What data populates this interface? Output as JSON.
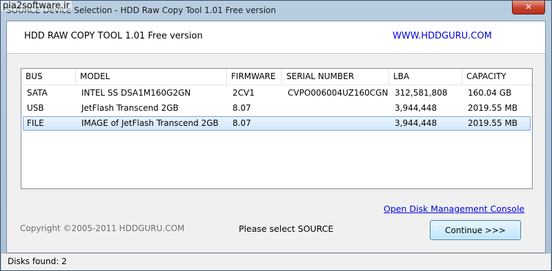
{
  "window": {
    "title": "SOURCE Device Selection - HDD Raw Copy Tool 1.01    Free version",
    "watermark": "pia2software.ir",
    "close_glyph": "✕"
  },
  "header": {
    "app_name": "HDD RAW COPY TOOL 1.01    Free version",
    "website": "WWW.HDDGURU.COM"
  },
  "table": {
    "columns": [
      "BUS",
      "MODEL",
      "FIRMWARE",
      "SERIAL NUMBER",
      "LBA",
      "CAPACITY"
    ],
    "rows": [
      {
        "bus": "SATA",
        "model": "INTEL SS DSA1M160G2GN",
        "firmware": "2CV1",
        "serial": "CVPO006004UZ160CGN",
        "lba": "312,581,808",
        "capacity": "160.04 GB",
        "selected": false
      },
      {
        "bus": "USB",
        "model": "JetFlash Transcend 2GB",
        "firmware": "8.07",
        "serial": "",
        "lba": "3,944,448",
        "capacity": "2019.55 MB",
        "selected": false
      },
      {
        "bus": "FILE",
        "model": "IMAGE of JetFlash Transcend 2GB",
        "firmware": "8.07",
        "serial": "",
        "lba": "3,944,448",
        "capacity": "2019.55 MB",
        "selected": true
      }
    ]
  },
  "footer": {
    "disk_mgmt_link": "Open Disk Management Console",
    "copyright": "Copyright ©2005-2011 HDDGURU.COM",
    "status_message": "Please select SOURCE",
    "continue_label": "Continue >>>"
  },
  "statusbar": {
    "disks_found": "Disks found: 2"
  },
  "colors": {
    "link": "#0000e0",
    "selection": "#d2e7fc",
    "close_button": "#c9412b"
  }
}
